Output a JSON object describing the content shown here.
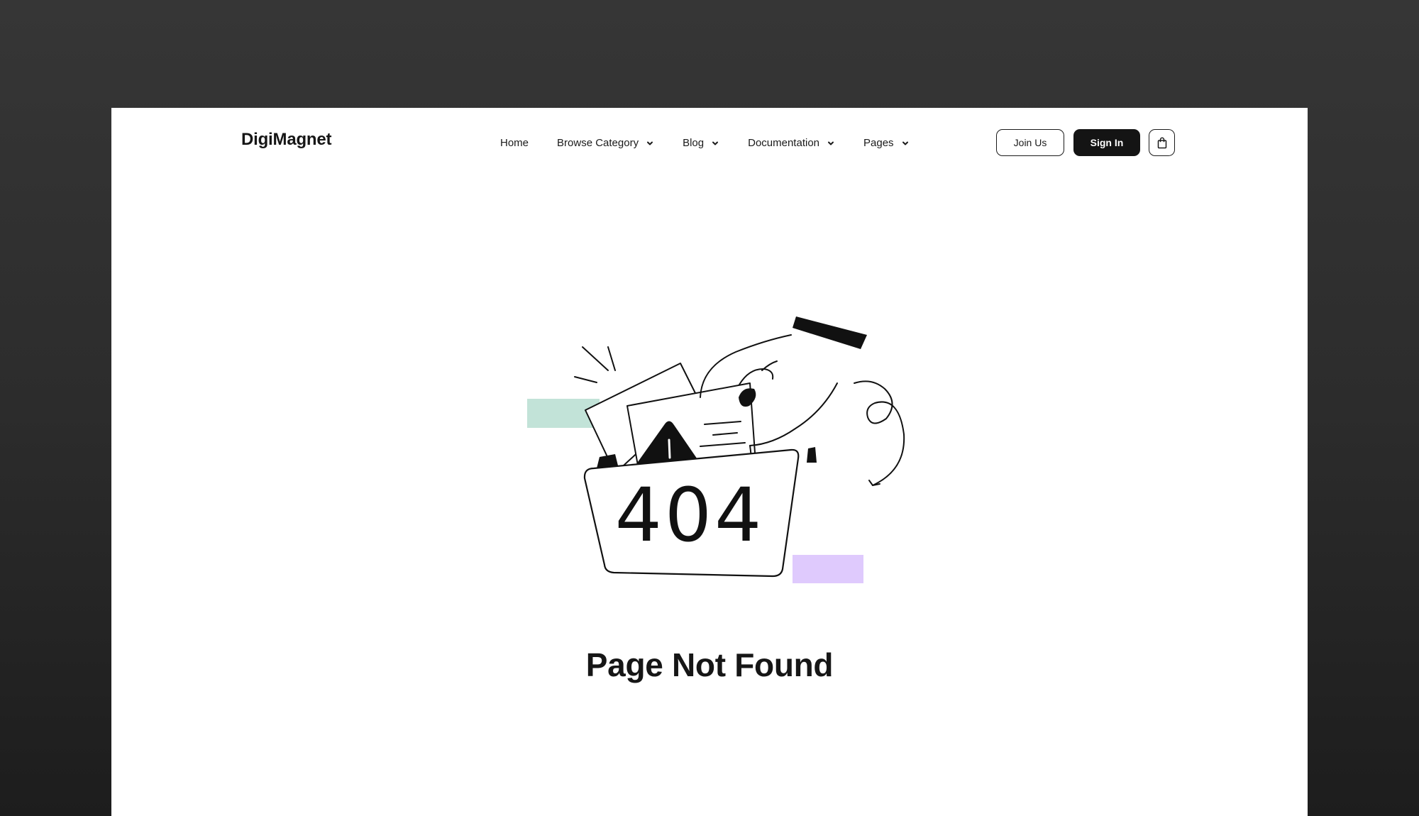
{
  "brand": {
    "logo_text": "DigiMagnet"
  },
  "nav": {
    "home": "Home",
    "browse_category": "Browse Category",
    "blog": "Blog",
    "documentation": "Documentation",
    "pages": "Pages"
  },
  "actions": {
    "join_label": "Join Us",
    "signin_label": "Sign In",
    "cart_icon": "shopping-bag-icon"
  },
  "error": {
    "code": "404",
    "title": "Page Not Found",
    "illustration": "hand-pulling-warning-document-from-folder",
    "accent_green": "#c2e3d8",
    "accent_purple": "#dfcafd"
  },
  "colors": {
    "background_dark": "#2f2f2f",
    "page_background": "#ffffff",
    "ink": "#141414"
  }
}
